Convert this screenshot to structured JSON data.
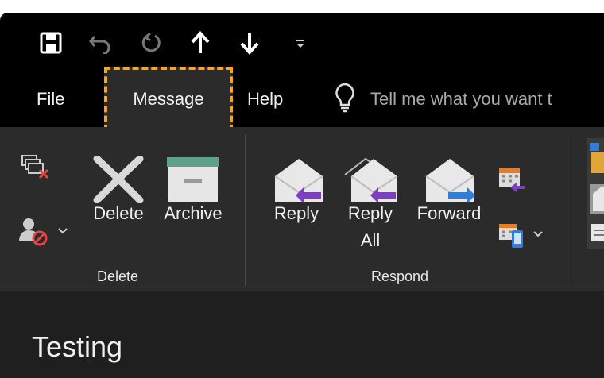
{
  "tabs": {
    "file": "File",
    "message": "Message",
    "help": "Help"
  },
  "search": {
    "placeholder": "Tell me what you want t"
  },
  "ribbon": {
    "delete_group": {
      "label": "Delete",
      "delete_button": "Delete",
      "archive_button": "Archive"
    },
    "respond_group": {
      "label": "Respond",
      "reply_button": "Reply",
      "reply_all_line1": "Reply",
      "reply_all_line2": "All",
      "forward_button": "Forward"
    }
  },
  "message": {
    "subject": "Testing"
  },
  "colors": {
    "highlight": "#f5a623",
    "reply_arrow": "#7b3fbf",
    "forward_arrow": "#2f7fd6",
    "archive_lid": "#5fa18a"
  }
}
